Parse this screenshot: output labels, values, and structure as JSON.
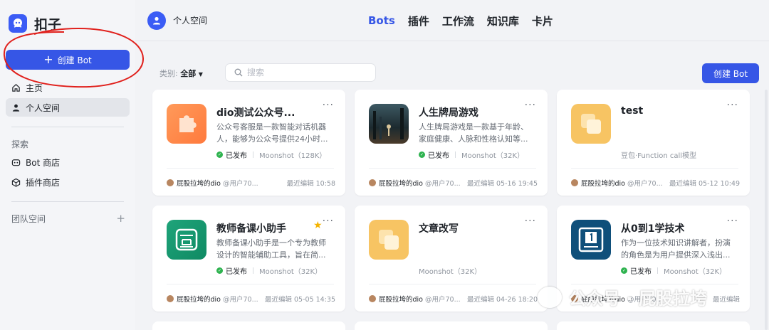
{
  "sidebar": {
    "brand": "扣子",
    "create_button": "创建 Bot",
    "nav": [
      {
        "label": "主页",
        "icon": "home-icon"
      },
      {
        "label": "个人空间",
        "icon": "person-icon"
      }
    ],
    "explore_label": "探索",
    "explore": [
      {
        "label": "Bot 商店",
        "icon": "bot-icon"
      },
      {
        "label": "插件商店",
        "icon": "cube-icon"
      }
    ],
    "team_label": "团队空间",
    "team_add": "+"
  },
  "header": {
    "space_name": "个人空间",
    "tabs": [
      "Bots",
      "插件",
      "工作流",
      "知识库",
      "卡片"
    ]
  },
  "filter": {
    "category_label": "类别:",
    "category_value": "全部",
    "search_placeholder": "搜索",
    "create_button": "创建 Bot"
  },
  "cards": [
    {
      "title": "dio测试公众号...",
      "desc": "公众号客服是一款智能对话机器人，能够为公众号提供24小时...",
      "status": "已发布",
      "model": "Moonshot（128K）",
      "author": "屁股拉垮的dio",
      "handle": "@用户70...",
      "edited": "最近编辑 10:58"
    },
    {
      "title": "人生牌局游戏",
      "desc": "人生牌局游戏是一款基于年龄、家庭健康、人脉和性格认知等...",
      "status": "已发布",
      "model": "Moonshot（32K）",
      "author": "屁股拉垮的dio",
      "handle": "@用户70...",
      "edited": "最近编辑 05-16 19:45"
    },
    {
      "title": "test",
      "desc": "",
      "status": "",
      "model": "豆包·Function call模型",
      "author": "屁股拉垮的dio",
      "handle": "@用户70...",
      "edited": "最近编辑 05-12 10:49"
    },
    {
      "title": "教师备课小助手",
      "desc": "教师备课小助手是一个专为教师设计的智能辅助工具，旨在简...",
      "status": "已发布",
      "model": "Moonshot（32K）",
      "author": "屁股拉垮的dio",
      "handle": "@用户70...",
      "edited": "最近编辑 05-05 14:35"
    },
    {
      "title": "文章改写",
      "desc": "",
      "status": "",
      "model": "Moonshot（32K）",
      "author": "屁股拉垮的dio",
      "handle": "@用户70...",
      "edited": "最近编辑 04-26 18:20"
    },
    {
      "title": "从0到1学技术",
      "desc": "作为一位技术知识讲解者，扮演的角色是为用户提供深入浅出...",
      "status": "已发布",
      "model": "Moonshot（32K）",
      "author": "屁股拉垮的dio",
      "handle": "@用户70...",
      "edited": "最近编辑"
    }
  ],
  "watermark": "公众号 · 屁股拉垮",
  "colors": {
    "accent": "#3656e6",
    "published": "#2fb350",
    "annotation": "#e0201c"
  }
}
